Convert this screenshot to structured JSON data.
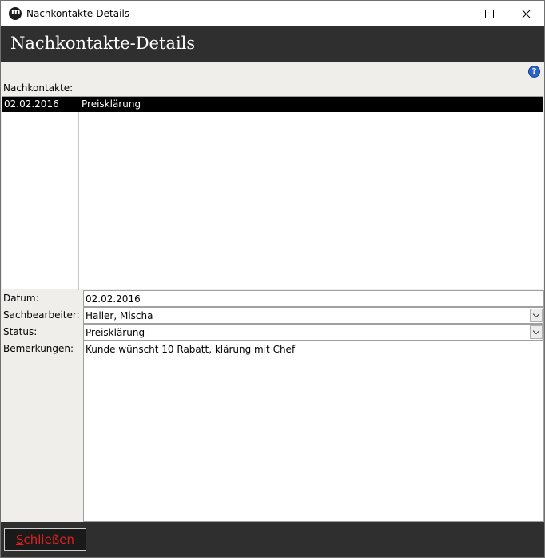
{
  "window": {
    "title": "Nachkontakte-Details"
  },
  "header": {
    "title": "Nachkontakte-Details"
  },
  "help": {
    "icon": "help-icon",
    "glyph": "?"
  },
  "list": {
    "caption": "Nachkontakte:",
    "rows": [
      {
        "date": "02.02.2016",
        "topic": "Preisklärung",
        "selected": true
      }
    ]
  },
  "form": {
    "datum": {
      "label": "Datum:",
      "value": "02.02.2016"
    },
    "sachbearbeiter": {
      "label": "Sachbearbeiter:",
      "value": "Haller, Mischa"
    },
    "status": {
      "label": "Status:",
      "value": "Preisklärung"
    },
    "bemerkungen": {
      "label": "Bemerkungen:",
      "value": "Kunde wünscht 10 Rabatt, klärung mit Chef"
    }
  },
  "footer": {
    "close_mnemonic": "S",
    "close_rest": "chließen"
  },
  "colors": {
    "header_bg": "#2f2f2f",
    "selected_row_bg": "#000000",
    "close_text": "#e02020"
  }
}
